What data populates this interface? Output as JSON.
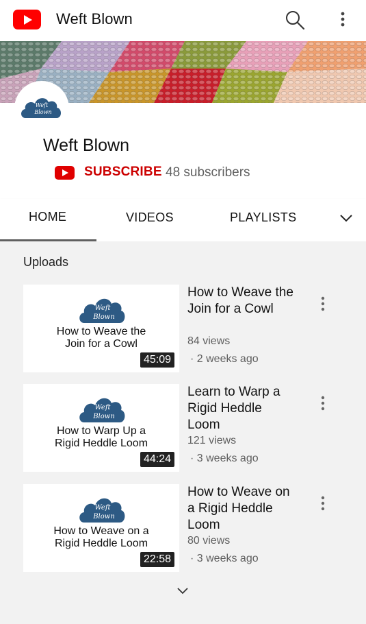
{
  "app": {
    "title": "Weft Blown",
    "logo_icon": "youtube-logo-icon",
    "brand_color": "#ff0000"
  },
  "channel": {
    "name": "Weft Blown",
    "avatar_text_1": "Weft",
    "avatar_text_2": "Blown",
    "subscribe_label": "SUBSCRIBE",
    "subscribers": "48 subscribers"
  },
  "tabs": [
    {
      "label": "HOME",
      "selected": true
    },
    {
      "label": "VIDEOS",
      "selected": false
    },
    {
      "label": "PLAYLISTS",
      "selected": false
    }
  ],
  "section": {
    "title": "Uploads"
  },
  "videos": [
    {
      "thumb_line1": "How to Weave the",
      "thumb_line2": "Join for a Cowl",
      "duration": "45:09",
      "title": "How to Weave the Join for a Cowl",
      "views": "84 views",
      "age": "· 2 weeks ago"
    },
    {
      "thumb_line1": "How to Warp Up a",
      "thumb_line2": "Rigid Heddle Loom",
      "duration": "44:24",
      "title": "Learn to Warp a Rigid Heddle Loom",
      "views": "121 views",
      "age": "· 3 weeks ago"
    },
    {
      "thumb_line1": "How to Weave on a",
      "thumb_line2": "Rigid Heddle Loom",
      "duration": "22:58",
      "title": "How to Weave on a Rigid Heddle Loom",
      "views": "80 views",
      "age": "· 3 weeks ago"
    }
  ]
}
